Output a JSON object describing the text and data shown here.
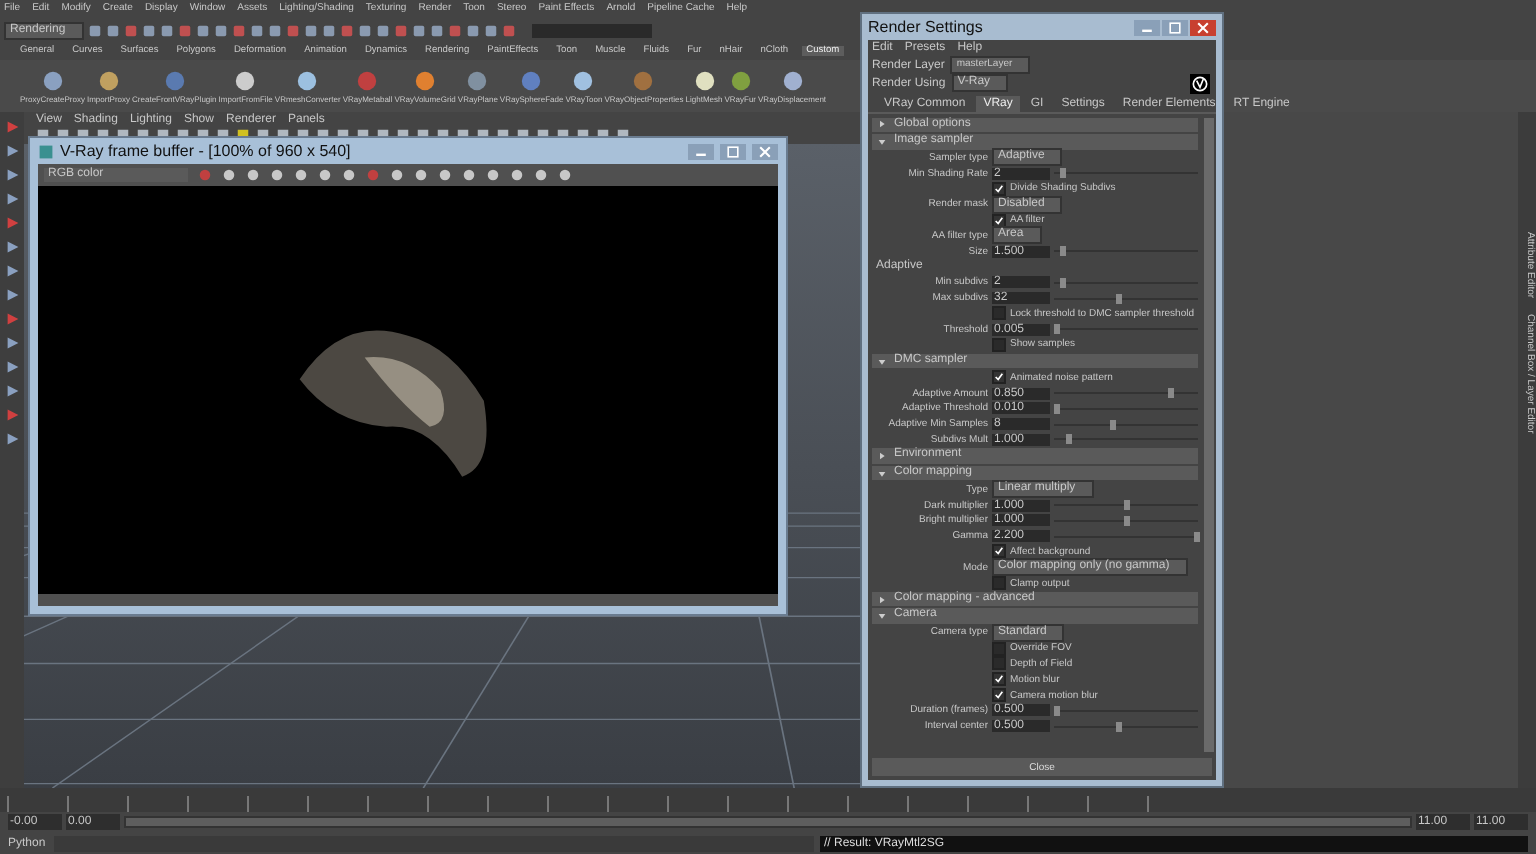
{
  "menu_bar": [
    "File",
    "Edit",
    "Modify",
    "Create",
    "Display",
    "Window",
    "Assets",
    "Lighting/Shading",
    "Texturing",
    "Render",
    "Toon",
    "Stereo",
    "Paint Effects",
    "Arnold",
    "Pipeline Cache",
    "Help"
  ],
  "mode_dropdown": "Rendering",
  "shelf_tabs": [
    {
      "label": "General",
      "selected": false
    },
    {
      "label": "Curves",
      "selected": false
    },
    {
      "label": "Surfaces",
      "selected": false
    },
    {
      "label": "Polygons",
      "selected": false
    },
    {
      "label": "Deformation",
      "selected": false
    },
    {
      "label": "Animation",
      "selected": false
    },
    {
      "label": "Dynamics",
      "selected": false
    },
    {
      "label": "Rendering",
      "selected": false
    },
    {
      "label": "PaintEffects",
      "selected": false
    },
    {
      "label": "Toon",
      "selected": false
    },
    {
      "label": "Muscle",
      "selected": false
    },
    {
      "label": "Fluids",
      "selected": false
    },
    {
      "label": "Fur",
      "selected": false
    },
    {
      "label": "nHair",
      "selected": false
    },
    {
      "label": "nCloth",
      "selected": false
    },
    {
      "label": "Custom",
      "selected": true
    }
  ],
  "shelf_items": [
    "ProxyCreateProxy",
    "ImportProxy",
    "CreateFrontVRayPlugin",
    "ImportFromFile",
    "VRmeshConverter",
    "VRayMetaball",
    "VRayVolumeGrid",
    "VRayPlane",
    "VRaySphereFade",
    "VRayToon",
    "VRayObjectProperties",
    "LightMesh",
    "VRayFur",
    "VRayDisplacement"
  ],
  "viewport_menu": [
    "View",
    "Shading",
    "Lighting",
    "Show",
    "Renderer",
    "Panels"
  ],
  "frame_buffer": {
    "title": "V-Ray frame buffer - [100% of 960 x 540]",
    "channel": "RGB color"
  },
  "render_settings": {
    "title": "Render Settings",
    "menus": [
      "Edit",
      "Presets",
      "Help"
    ],
    "render_layer": {
      "label": "Render Layer",
      "value": "masterLayer"
    },
    "render_using": {
      "label": "Render Using",
      "value": "V-Ray"
    },
    "tabs": [
      {
        "label": "VRay Common",
        "selected": false
      },
      {
        "label": "VRay",
        "selected": true
      },
      {
        "label": "GI",
        "selected": false
      },
      {
        "label": "Settings",
        "selected": false
      },
      {
        "label": "Render Elements",
        "selected": false
      },
      {
        "label": "RT Engine",
        "selected": false
      }
    ],
    "sections": [
      {
        "title": "Global options",
        "expanded": false
      },
      {
        "title": "Image sampler",
        "expanded": true,
        "rows": [
          {
            "kind": "dropdown",
            "label": "Sampler type",
            "value": "Adaptive"
          },
          {
            "kind": "number",
            "label": "Min Shading Rate",
            "value": "2",
            "level": 0.05
          },
          {
            "kind": "checkbox",
            "label": "Divide Shading Subdivs",
            "checked": true
          },
          {
            "kind": "dropdown",
            "label": "Render mask",
            "value": "Disabled"
          },
          {
            "kind": "checkbox",
            "label": "AA filter",
            "checked": true
          },
          {
            "kind": "dropdown",
            "label": "AA filter type",
            "value": "Area"
          },
          {
            "kind": "number",
            "label": "Size",
            "value": "1.500",
            "level": 0.05
          },
          {
            "kind": "heading",
            "label": "Adaptive"
          },
          {
            "kind": "number",
            "label": "Min subdivs",
            "value": "2",
            "level": 0.05
          },
          {
            "kind": "number",
            "label": "Max subdivs",
            "value": "32",
            "level": 0.45
          },
          {
            "kind": "checkbox",
            "label": "Lock threshold to DMC sampler threshold",
            "checked": false
          },
          {
            "kind": "number",
            "label": "Threshold",
            "value": "0.005",
            "level": 0.02
          },
          {
            "kind": "checkbox",
            "label": "Show samples",
            "checked": false
          }
        ]
      },
      {
        "title": "DMC sampler",
        "expanded": true,
        "rows": [
          {
            "kind": "checkbox",
            "label": "Animated noise pattern",
            "checked": true
          },
          {
            "kind": "number",
            "label": "Adaptive Amount",
            "value": "0.850",
            "level": 0.8
          },
          {
            "kind": "number",
            "label": "Adaptive Threshold",
            "value": "0.010",
            "level": 0.02
          },
          {
            "kind": "number",
            "label": "Adaptive Min Samples",
            "value": "8",
            "level": 0.4
          },
          {
            "kind": "number",
            "label": "Subdivs Mult",
            "value": "1.000",
            "level": 0.1
          }
        ]
      },
      {
        "title": "Environment",
        "expanded": false
      },
      {
        "title": "Color mapping",
        "expanded": true,
        "rows": [
          {
            "kind": "dropdown",
            "label": "Type",
            "value": "Linear multiply"
          },
          {
            "kind": "number",
            "label": "Dark multiplier",
            "value": "1.000",
            "level": 0.5
          },
          {
            "kind": "number",
            "label": "Bright multiplier",
            "value": "1.000",
            "level": 0.5
          },
          {
            "kind": "number",
            "label": "Gamma",
            "value": "2.200",
            "level": 0.98
          },
          {
            "kind": "checkbox",
            "label": "Affect background",
            "checked": true
          },
          {
            "kind": "dropdown",
            "label": "Mode",
            "value": "Color mapping only (no gamma)"
          },
          {
            "kind": "checkbox",
            "label": "Clamp output",
            "checked": false
          }
        ]
      },
      {
        "title": "Color mapping - advanced",
        "expanded": false
      },
      {
        "title": "Camera",
        "expanded": true,
        "rows": [
          {
            "kind": "dropdown",
            "label": "Camera type",
            "value": "Standard"
          },
          {
            "kind": "checkbox",
            "label": "Override FOV",
            "checked": false
          },
          {
            "kind": "checkbox",
            "label": "Depth of Field",
            "checked": false
          },
          {
            "kind": "checkbox",
            "label": "Motion blur",
            "checked": true
          },
          {
            "kind": "checkbox",
            "label": "Camera motion blur",
            "checked": true
          },
          {
            "kind": "number",
            "label": "Duration (frames)",
            "value": "0.500",
            "level": 0.02
          },
          {
            "kind": "number",
            "label": "Interval center",
            "value": "0.500",
            "level": 0.45
          }
        ]
      }
    ],
    "close_button": "Close"
  },
  "side_panel_tabs": [
    "Attribute Editor",
    "Channel Box / Layer Editor"
  ],
  "range_bar": {
    "start": "-0.00",
    "inner_start": "0.00",
    "inner_end": "11.00",
    "end": "11.00",
    "level": 1
  },
  "command_line": {
    "language": "Python",
    "result": "// Result: VRayMtl2SG"
  }
}
